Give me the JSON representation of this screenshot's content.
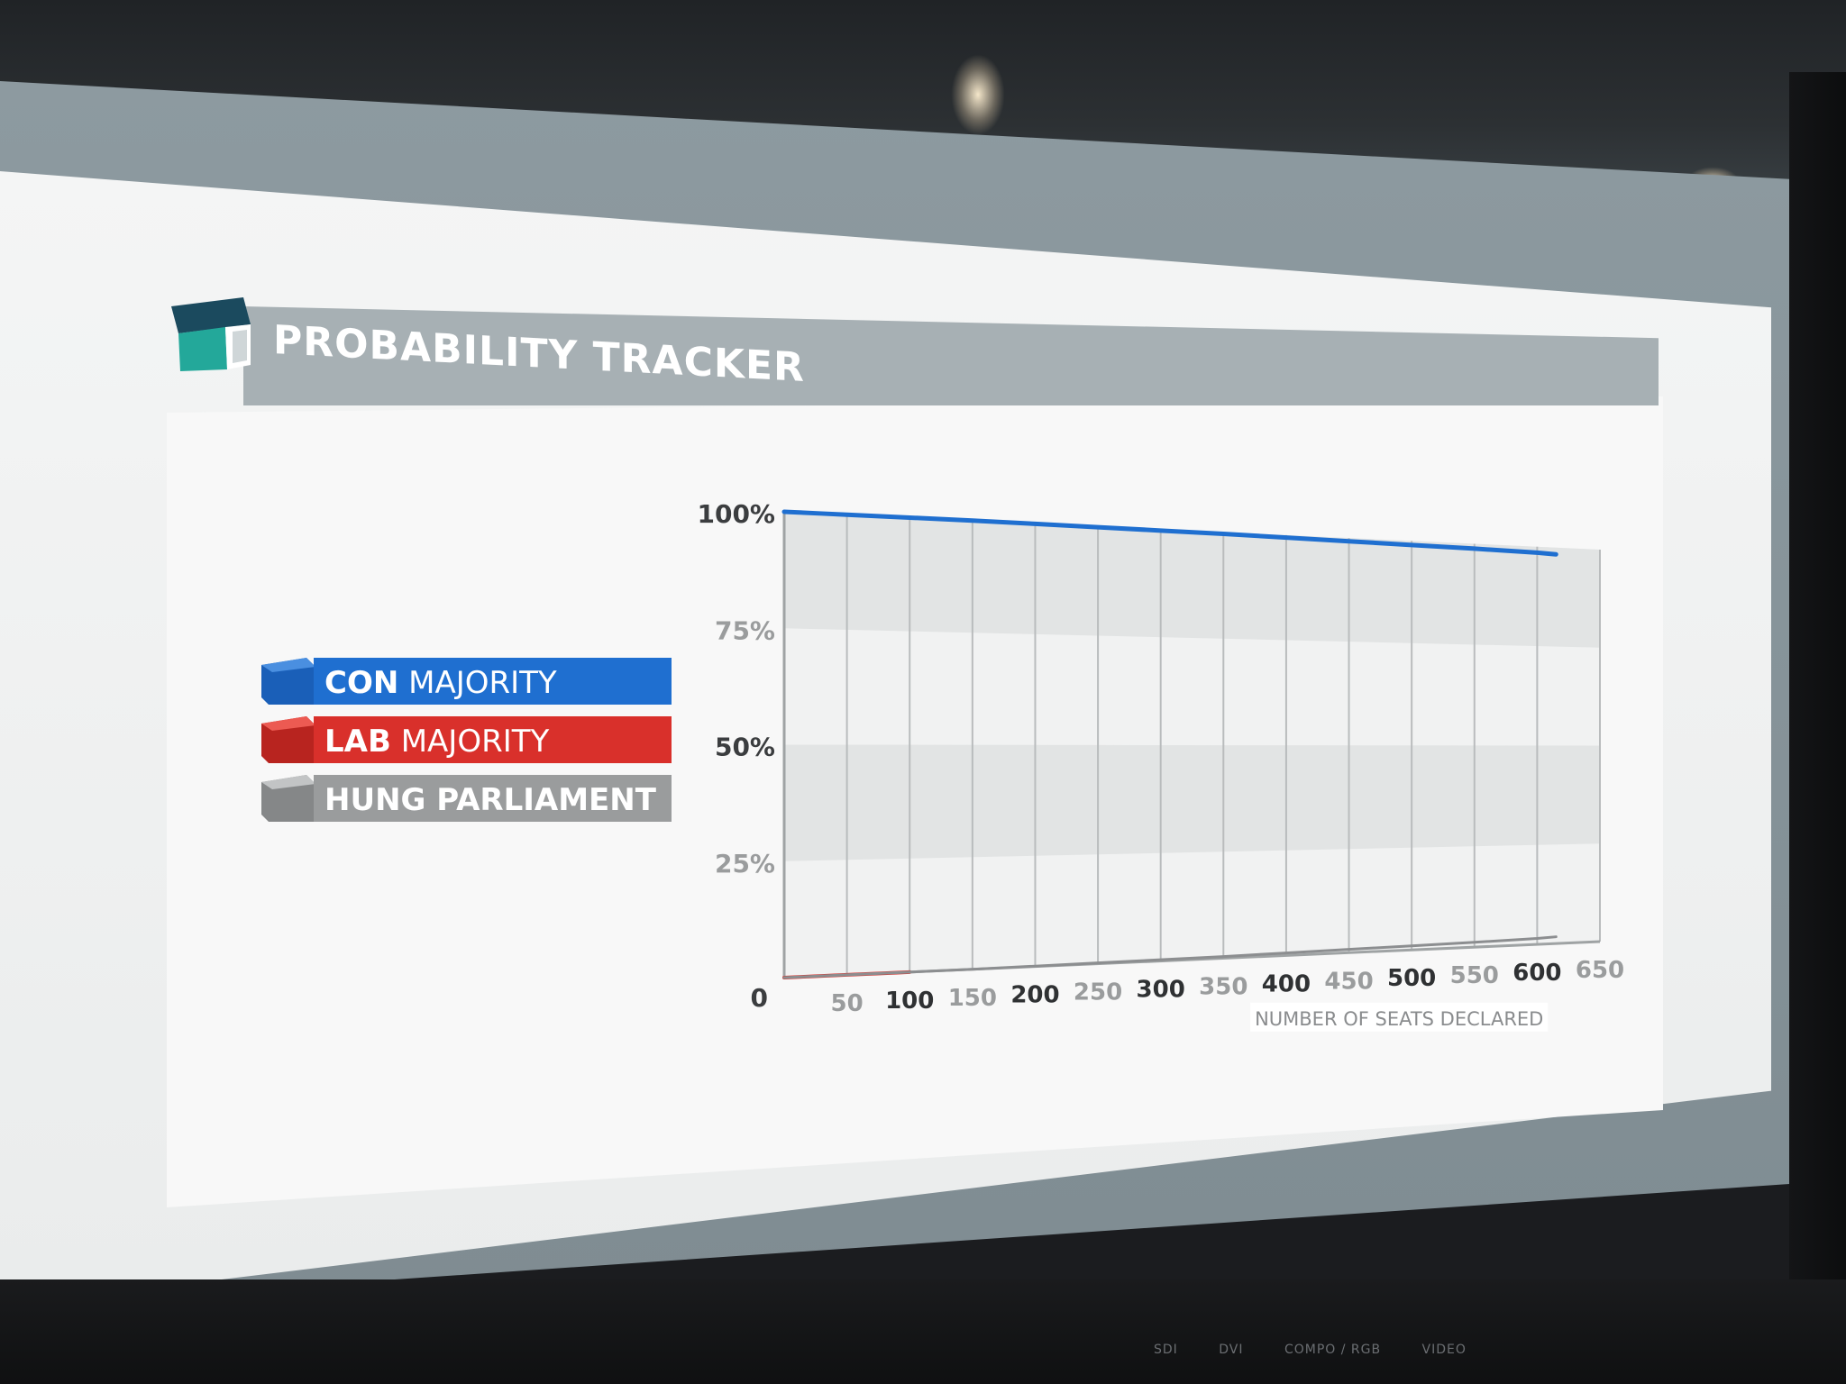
{
  "title": "PROBABILITY TRACKER",
  "legend": [
    {
      "bold": "CON",
      "rest": " MAJORITY",
      "color": "#1f6fd0"
    },
    {
      "bold": "LAB",
      "rest": " MAJORITY",
      "color": "#d9302b"
    },
    {
      "bold": "HUNG",
      "rest": " PARLIAMENT",
      "color": "#9a9c9d"
    }
  ],
  "bezel": [
    "SDI",
    "DVI",
    "COMPO / RGB",
    "VIDEO"
  ],
  "chart_data": {
    "type": "line",
    "xlabel": "NUMBER OF SEATS DECLARED",
    "ylabel": "",
    "xlim": [
      0,
      650
    ],
    "ylim": [
      0,
      100
    ],
    "x_ticks": [
      "50",
      "100",
      "150",
      "200",
      "250",
      "300",
      "350",
      "400",
      "450",
      "500",
      "550",
      "600",
      "650"
    ],
    "y_ticks": [
      "0",
      "25%",
      "50%",
      "75%",
      "100%"
    ],
    "series": [
      {
        "name": "CON MAJORITY",
        "color": "#1f6fd0",
        "x": [
          0,
          10,
          30,
          50,
          75,
          100,
          150,
          200,
          250,
          300,
          350,
          400,
          450,
          500,
          550,
          600,
          615
        ],
        "y": [
          100,
          100,
          100,
          100,
          100,
          100,
          100,
          99.9,
          99.8,
          99.7,
          99.6,
          99.4,
          99.2,
          99.0,
          98.8,
          98.5,
          98.3
        ]
      },
      {
        "name": "LAB MAJORITY",
        "color": "#d9302b",
        "x": [
          0,
          20,
          50,
          80,
          100
        ],
        "y": [
          0,
          0,
          0,
          0,
          0
        ]
      },
      {
        "name": "HUNG PARLIAMENT",
        "color": "#8c8e90",
        "x": [
          0,
          10,
          30,
          50,
          75,
          100,
          150,
          200,
          250,
          300,
          350,
          400,
          450,
          500,
          550,
          600,
          615
        ],
        "y": [
          0,
          0,
          0,
          0,
          0,
          0,
          0,
          0.1,
          0.2,
          0.3,
          0.4,
          0.6,
          0.8,
          1.0,
          1.2,
          1.5,
          1.7
        ]
      }
    ]
  }
}
